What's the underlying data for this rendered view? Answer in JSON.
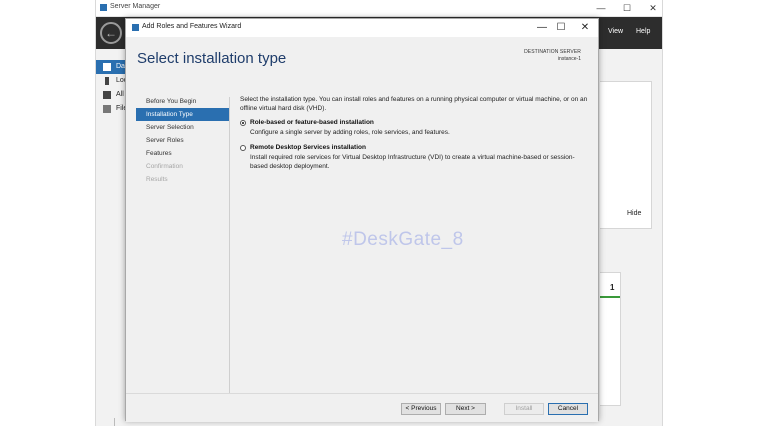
{
  "server_manager": {
    "title": "Server Manager",
    "menu": {
      "view": "View",
      "help": "Help"
    },
    "nav": [
      {
        "label": "Da",
        "active": true
      },
      {
        "label": "Loc",
        "active": false
      },
      {
        "label": "All",
        "active": false
      },
      {
        "label": "File",
        "active": false
      }
    ],
    "hide_label": "Hide",
    "tile_count": "1"
  },
  "wizard": {
    "title": "Add Roles and Features Wizard",
    "heading": "Select installation type",
    "destination": {
      "label": "DESTINATION SERVER",
      "value": "instance-1"
    },
    "steps": [
      {
        "label": "Before You Begin",
        "state": "normal"
      },
      {
        "label": "Installation Type",
        "state": "active"
      },
      {
        "label": "Server Selection",
        "state": "normal"
      },
      {
        "label": "Server Roles",
        "state": "normal"
      },
      {
        "label": "Features",
        "state": "normal"
      },
      {
        "label": "Confirmation",
        "state": "disabled"
      },
      {
        "label": "Results",
        "state": "disabled"
      }
    ],
    "intro": "Select the installation type. You can install roles and features on a running physical computer or virtual machine, or on an offline virtual hard disk (VHD).",
    "options": [
      {
        "title": "Role-based or feature-based installation",
        "description": "Configure a single server by adding roles, role services, and features.",
        "selected": true
      },
      {
        "title": "Remote Desktop Services installation",
        "description": "Install required role services for Virtual Desktop Infrastructure (VDI) to create a virtual machine-based or session-based desktop deployment.",
        "selected": false
      }
    ],
    "buttons": {
      "previous": "< Previous",
      "next": "Next >",
      "install": "Install",
      "cancel": "Cancel"
    }
  },
  "watermark": "#DeskGate_8",
  "colors": {
    "accent": "#2a6fb0",
    "heading": "#1f3d6b",
    "header_dark": "#2d2d2d"
  },
  "icons": {
    "back": "back-arrow-icon",
    "minimize": "minimize-icon",
    "maximize": "maximize-icon",
    "close": "close-icon"
  }
}
